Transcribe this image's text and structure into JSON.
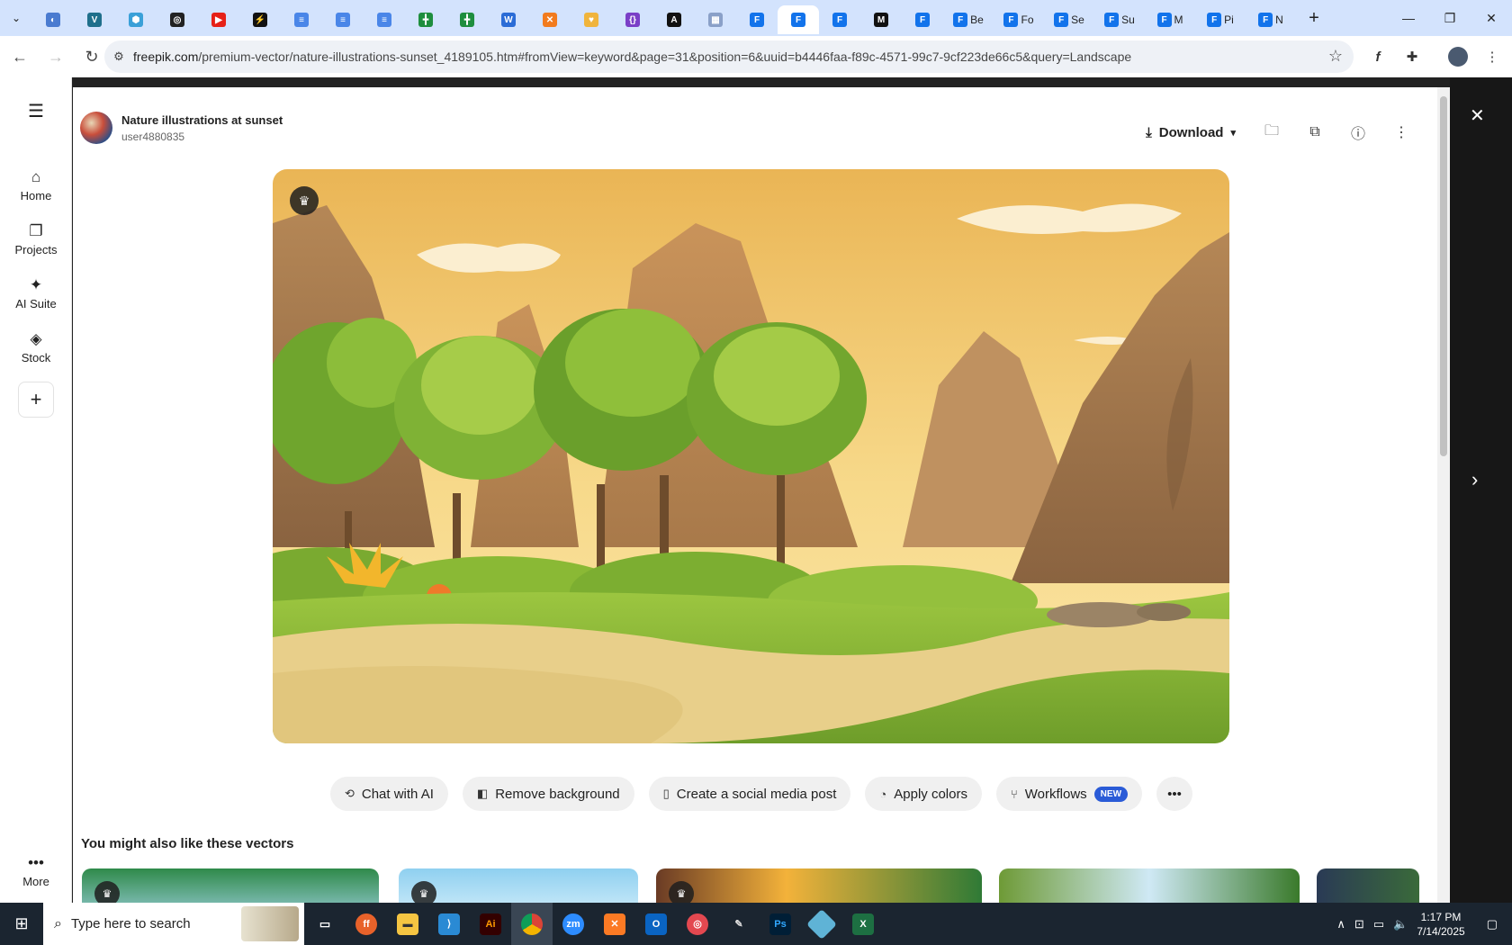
{
  "browser": {
    "tabs": [
      {
        "icon": "globe-icon",
        "color": "#4a7bd0",
        "glyph": "◐",
        "label": ""
      },
      {
        "icon": "shield-v-icon",
        "color": "#1f6f8b",
        "glyph": "V",
        "label": ""
      },
      {
        "icon": "hex-icon",
        "color": "#3aa0d8",
        "glyph": "⬢",
        "label": ""
      },
      {
        "icon": "openai-icon",
        "color": "#222222",
        "glyph": "◎",
        "label": ""
      },
      {
        "icon": "youtube-icon",
        "color": "#e62117",
        "glyph": "▶",
        "label": ""
      },
      {
        "icon": "bolt-icon",
        "color": "#111111",
        "glyph": "⚡",
        "label": ""
      },
      {
        "icon": "docs-icon",
        "color": "#4a86e8",
        "glyph": "≡",
        "label": ""
      },
      {
        "icon": "docs-icon",
        "color": "#4a86e8",
        "glyph": "≡",
        "label": ""
      },
      {
        "icon": "docs-icon",
        "color": "#4a86e8",
        "glyph": "≡",
        "label": ""
      },
      {
        "icon": "sheets-icon",
        "color": "#1e8e3e",
        "glyph": "╋",
        "label": ""
      },
      {
        "icon": "sheets-icon",
        "color": "#1e8e3e",
        "glyph": "╋",
        "label": ""
      },
      {
        "icon": "word-icon",
        "color": "#2b6cd6",
        "glyph": "W",
        "label": ""
      },
      {
        "icon": "xampp-icon",
        "color": "#f27b1d",
        "glyph": "✕",
        "label": ""
      },
      {
        "icon": "heart-icon",
        "color": "#f0b43c",
        "glyph": "♥",
        "label": ""
      },
      {
        "icon": "json-icon",
        "color": "#7a3fc7",
        "glyph": "{}",
        "label": ""
      },
      {
        "icon": "a-icon",
        "color": "#111111",
        "glyph": "A",
        "label": ""
      },
      {
        "icon": "grid-icon",
        "color": "#8aa0c8",
        "glyph": "▦",
        "label": ""
      },
      {
        "icon": "freepik-icon",
        "color": "#1273eb",
        "glyph": "F",
        "label": ""
      },
      {
        "icon": "freepik-icon",
        "color": "#1273eb",
        "glyph": "F",
        "label": "",
        "active": true
      },
      {
        "icon": "freepik-icon",
        "color": "#1273eb",
        "glyph": "F",
        "label": ""
      },
      {
        "icon": "m-icon",
        "color": "#111111",
        "glyph": "M",
        "label": ""
      },
      {
        "icon": "freepik-icon",
        "color": "#1273eb",
        "glyph": "F",
        "label": ""
      },
      {
        "icon": "freepik-icon",
        "color": "#1273eb",
        "glyph": "F",
        "label": "Be"
      },
      {
        "icon": "freepik-icon",
        "color": "#1273eb",
        "glyph": "F",
        "label": "Fo"
      },
      {
        "icon": "freepik-icon",
        "color": "#1273eb",
        "glyph": "F",
        "label": "Se"
      },
      {
        "icon": "freepik-icon",
        "color": "#1273eb",
        "glyph": "F",
        "label": "Su"
      },
      {
        "icon": "freepik-icon",
        "color": "#1273eb",
        "glyph": "F",
        "label": "M"
      },
      {
        "icon": "freepik-icon",
        "color": "#1273eb",
        "glyph": "F",
        "label": "Pi"
      },
      {
        "icon": "freepik-icon",
        "color": "#1273eb",
        "glyph": "F",
        "label": "N"
      }
    ],
    "url_domain": "freepik.com",
    "url_path": "/premium-vector/nature-illustrations-sunset_4189105.htm#fromView=keyword&page=31&position=6&uuid=b4446faa-f89c-4571-99c7-9cf223de66c5&query=Landscape"
  },
  "sidebar": {
    "items": [
      {
        "label": "Home",
        "icon": "home-icon",
        "glyph": "⌂"
      },
      {
        "label": "Projects",
        "icon": "projects-icon",
        "glyph": "❐"
      },
      {
        "label": "AI Suite",
        "icon": "sparkle-icon",
        "glyph": "✦"
      },
      {
        "label": "Stock",
        "icon": "stock-icon",
        "glyph": "◈"
      }
    ],
    "more_label": "More"
  },
  "asset": {
    "title": "Nature illustrations at sunset",
    "user": "user4880835",
    "download_label": "Download",
    "badge": "premium-crown-icon"
  },
  "tools": [
    {
      "label": "Chat with AI",
      "icon": "chat-ai-icon",
      "glyph": "⟲"
    },
    {
      "label": "Remove background",
      "icon": "remove-bg-icon",
      "glyph": "◧"
    },
    {
      "label": "Create a social media post",
      "icon": "phone-icon",
      "glyph": "▯"
    },
    {
      "label": "Apply colors",
      "icon": "palette-icon",
      "glyph": "◔"
    },
    {
      "label": "Workflows",
      "icon": "workflow-icon",
      "glyph": "⑂",
      "badge": "NEW"
    }
  ],
  "related": {
    "title": "You might also like these vectors"
  },
  "taskbar": {
    "search_placeholder": "Type here to search",
    "time": "1:17 PM",
    "date": "7/14/2025"
  }
}
